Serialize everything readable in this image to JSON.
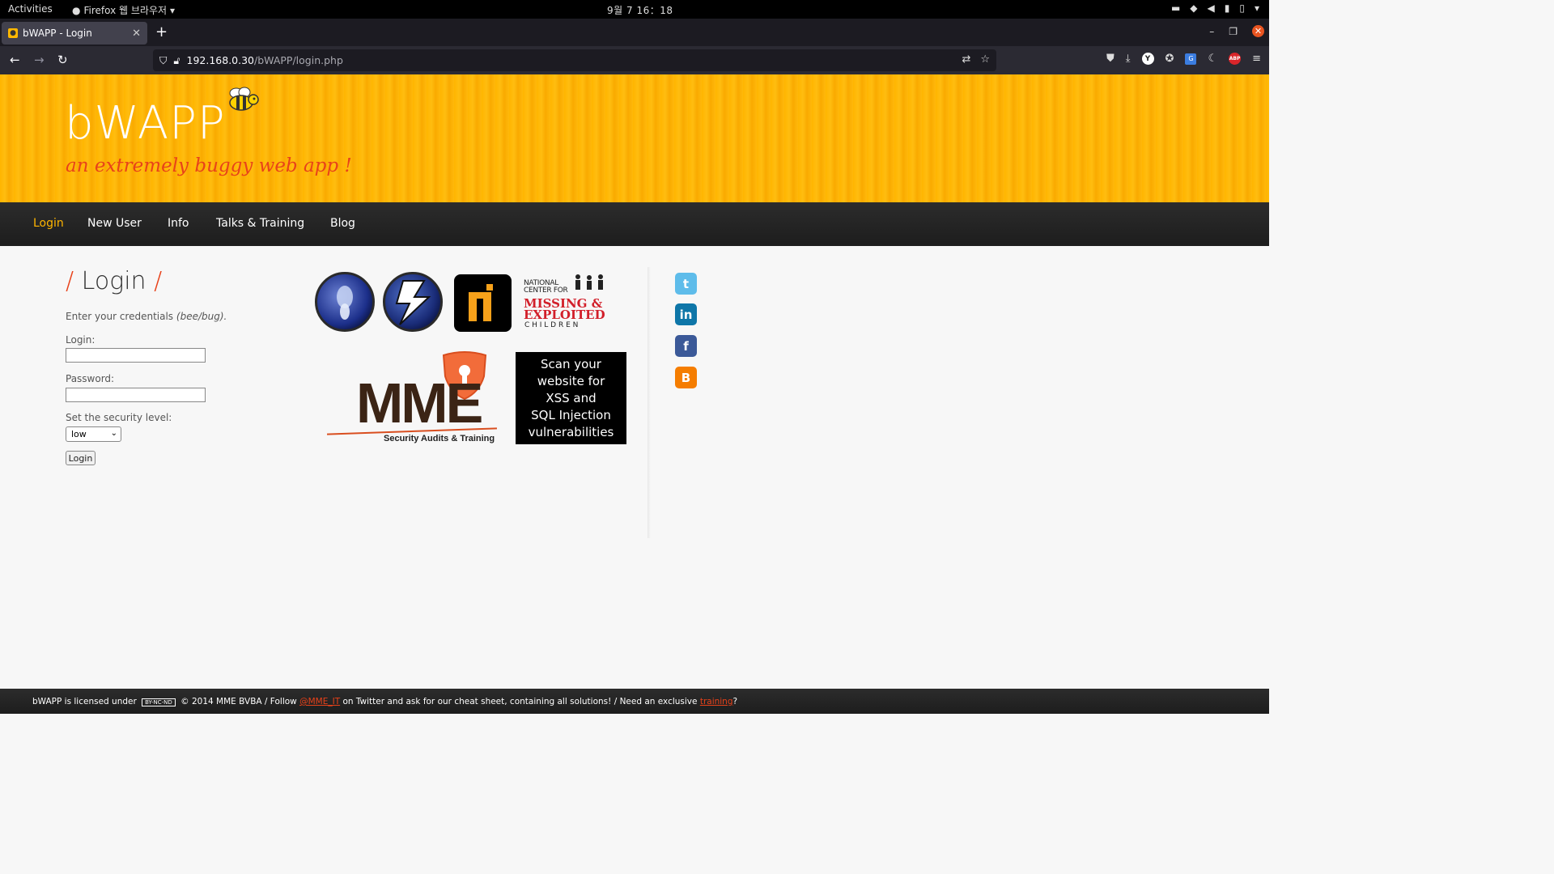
{
  "os": {
    "activities": "Activities",
    "app_menu": "Firefox 웹 브라우저",
    "clock": "9월 7  16：18"
  },
  "browser": {
    "tab_title": "bWAPP - Login",
    "url_host": "192.168.0.30",
    "url_path": "/bWAPP/login.php"
  },
  "header": {
    "logo": "bWAPP",
    "tagline": "an extremely buggy web app !"
  },
  "menu": {
    "items": [
      "Login",
      "New User",
      "Info",
      "Talks & Training",
      "Blog"
    ]
  },
  "login": {
    "title": "Login",
    "instructions": "Enter your credentials",
    "hint": "(bee/bug).",
    "login_label": "Login:",
    "password_label": "Password:",
    "security_label": "Set the security level:",
    "security_value": "low",
    "button": "Login"
  },
  "sponsors": {
    "ncmec_line1": "NATIONAL",
    "ncmec_line2": "CENTER FOR",
    "ncmec_line3": "MISSING &",
    "ncmec_line4": "EXPLOITED",
    "ncmec_line5": "C H I L D R E N",
    "mme_text": "MME",
    "mme_sub": "Security Audits & Training",
    "scan_line1": "Scan your",
    "scan_line2": "website for",
    "scan_line3": "XSS and",
    "scan_line4": "SQL Injection",
    "scan_line5": "vulnerabilities"
  },
  "social": {
    "twitter": "t",
    "linkedin": "in",
    "facebook": "f",
    "blogger": "B"
  },
  "footer": {
    "part1": "bWAPP is licensed under",
    "cc": "BY-NC-ND",
    "part2": "© 2014 MME BVBA / Follow",
    "twitter_handle": "@MME_IT",
    "part3": "on Twitter and ask for our cheat sheet, containing all solutions! / Need an exclusive",
    "training_link": "training",
    "part4": "?"
  },
  "colors": {
    "accent_orange": "#ffb500",
    "accent_red": "#e8421a",
    "dark_bar": "#1d1d1d"
  }
}
